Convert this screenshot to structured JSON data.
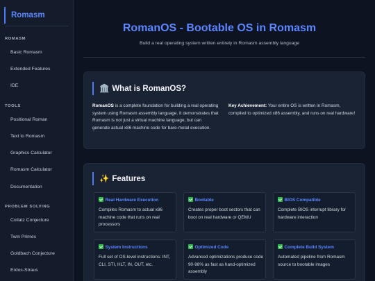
{
  "sidebar": {
    "brand": "Romasm",
    "sections": [
      {
        "title": "ROMASM",
        "items": [
          "Basic Romasm",
          "Extended Features",
          "IDE"
        ]
      },
      {
        "title": "TOOLS",
        "items": [
          "Positional Roman",
          "Text to Romasm",
          "Graphics Calculator",
          "Romasm Calculator",
          "Documentation"
        ]
      },
      {
        "title": "PROBLEM SOLVING",
        "items": [
          "Collatz Conjecture",
          "Twin Primes",
          "Goldbach Conjecture",
          "Erdos-Straus"
        ]
      }
    ]
  },
  "header": {
    "title": "RomanOS - Bootable OS in Romasm",
    "subtitle": "Build a real operating system written entirely in Romasm assembly language"
  },
  "about": {
    "icon": "🏛️",
    "title": "What is RomanOS?",
    "left_bold": "RomanOS",
    "left_text": " is a complete foundation for building a real operating system using Romasm assembly language. It demonstrates that Romasm is not just a virtual machine language, but can generate actual x86 machine code for bare-metal execution.",
    "right_bold": "Key Achievement:",
    "right_text": " Your entire OS is written in Romasm, compiled to optimized x86 assembly, and runs on real hardware!"
  },
  "features": {
    "icon": "✨",
    "title": "Features",
    "items": [
      {
        "title": "Real Hardware Execution",
        "desc": "Compiles Romasm to actual x86 machine code that runs on real processors"
      },
      {
        "title": "Bootable",
        "desc": "Creates proper boot sectors that can boot on real hardware or QEMU"
      },
      {
        "title": "BIOS Compatible",
        "desc": "Complete BIOS interrupt library for hardware interaction"
      },
      {
        "title": "System Instructions",
        "desc": "Full set of OS-level instructions: INT, CLI, STI, HLT, IN, OUT, etc."
      },
      {
        "title": "Optimized Code",
        "desc": "Advanced optimizations produce code 90-98% as fast as hand-optimized assembly"
      },
      {
        "title": "Complete Build System",
        "desc": "Automated pipeline from Romasm source to bootable images"
      }
    ]
  },
  "colors": {
    "accent": "#5a86ff",
    "check": "#2eb84b",
    "background": "#0d1321"
  }
}
